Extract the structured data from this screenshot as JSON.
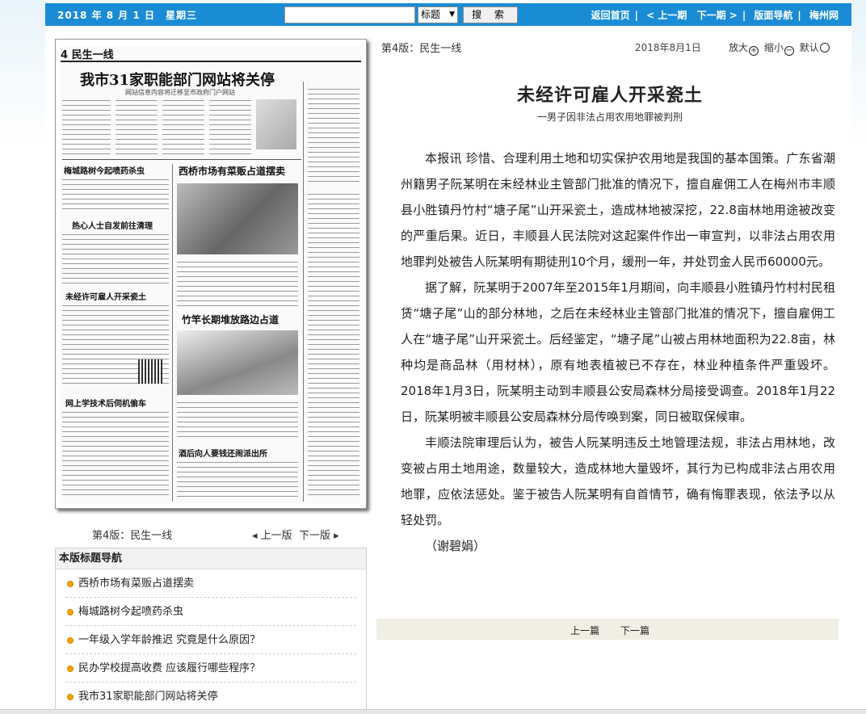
{
  "topbar": {
    "date": "2018 年 8 月 1 日　星期三",
    "search_placeholder": "",
    "search_field": "标题",
    "search_button": "搜 索",
    "nav": [
      "返回首页",
      "< 上一期",
      "下一期 >",
      "版面导航",
      "梅州网"
    ]
  },
  "newspaper": {
    "page_label": "4 民生一线",
    "headline": "我市31家职能部门网站将关停",
    "subhead": "网站信息内容将迁移至市政府门户网站",
    "titles": [
      "梅城路树今起喷药杀虫",
      "热心人士自发前往清理",
      "未经许可雇人开采瓷土",
      "西桥市场有菜贩占道摆卖",
      "竹竿长期堆放路边占道",
      "网上学技术后伺机偷车",
      "酒后向人要钱还闹派出所"
    ]
  },
  "edition": {
    "label": "第4版：民生一线",
    "prev": "上一版",
    "next": "下一版"
  },
  "nav_box": {
    "title": "本版标题导航",
    "items": [
      "西桥市场有菜贩占道摆卖",
      "梅城路树今起喷药杀虫",
      "一年级入学年龄推迟 究竟是什么原因？",
      "民办学校提高收费 应该履行哪些程序？",
      "我市31家职能部门网站将关停"
    ]
  },
  "article": {
    "edition": "第4版：民生一线",
    "date": "2018年8月1日",
    "zoom_in": "放大",
    "zoom_out": "缩小",
    "zoom_default": "默认",
    "title": "未经许可雇人开采瓷土",
    "subtitle": "一男子因非法占用农用地罪被判刑",
    "paragraphs": [
      "本报讯 珍惜、合理利用土地和切实保护农用地是我国的基本国策。广东省潮州籍男子阮某明在未经林业主管部门批准的情况下，擅自雇佣工人在梅州市丰顺县小胜镇丹竹村“塘子尾”山开采瓷土，造成林地被深挖，22.8亩林地用途被改变的严重后果。近日，丰顺县人民法院对这起案件作出一审宣判，以非法占用农用地罪判处被告人阮某明有期徒刑10个月，缓刑一年，并处罚金人民币60000元。",
      "据了解，阮某明于2007年至2015年1月期间，向丰顺县小胜镇丹竹村村民租赁“塘子尾”山的部分林地，之后在未经林业主管部门批准的情况下，擅自雇佣工人在“塘子尾”山开采瓷土。后经鉴定，“塘子尾”山被占用林地面积为22.8亩，林种均是商品林（用材林），原有地表植被已不存在，林业种植条件严重毁坏。2018年1月3日，阮某明主动到丰顺县公安局森林分局接受调查。2018年1月22日，阮某明被丰顺县公安局森林分局传唤到案，同日被取保候审。",
      "丰顺法院审理后认为，被告人阮某明违反土地管理法规，非法占用林地，改变被占用土地用途，数量较大，造成林地大量毁坏，其行为已构成非法占用农用地罪，应依法惩处。鉴于被告人阮某明有自首情节，确有悔罪表现，依法予以从轻处罚。",
      "（谢碧娟）"
    ],
    "prev": "上一篇",
    "next": "下一篇"
  }
}
